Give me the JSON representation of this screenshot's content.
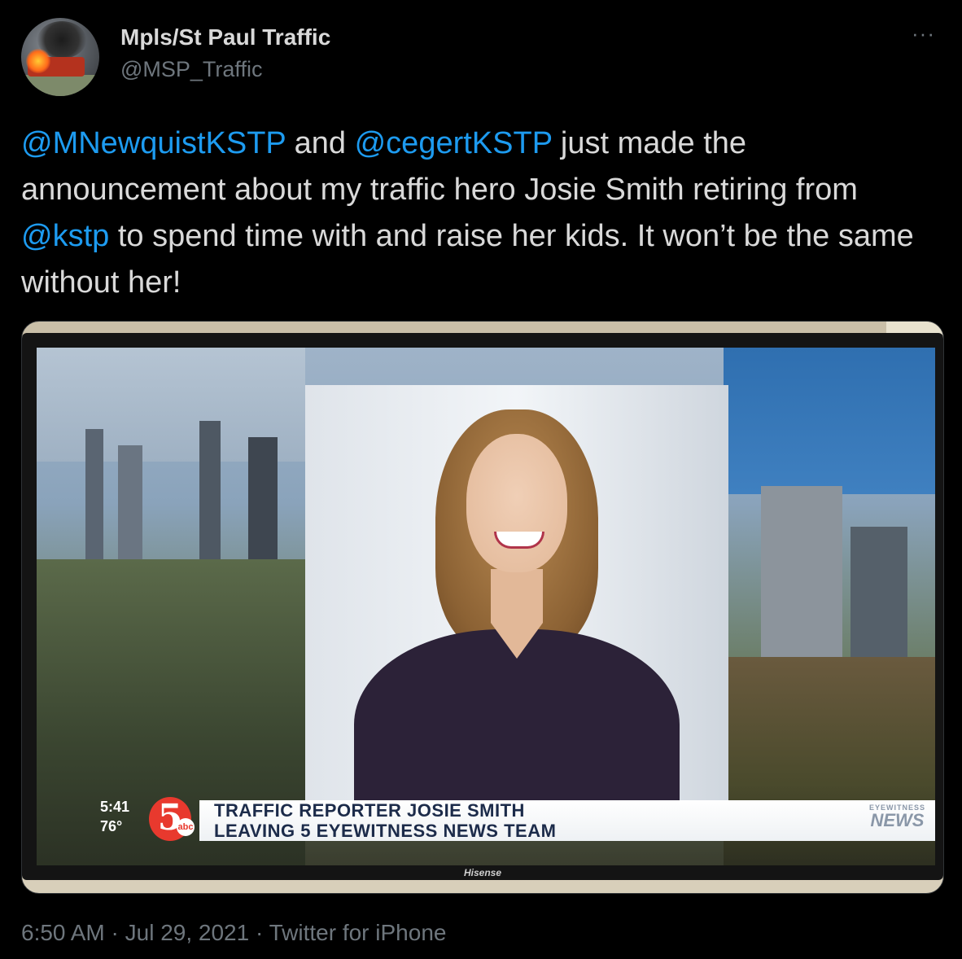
{
  "author": {
    "display_name": "Mpls/St Paul Traffic",
    "handle": "@MSP_Traffic",
    "avatar_icon": "avatar-bus-fire-icon"
  },
  "more_menu": {
    "icon": "more-icon",
    "label": "···"
  },
  "tweet": {
    "segments": [
      {
        "text": "@MNewquistKSTP",
        "type": "mention"
      },
      {
        "text": " and ",
        "type": "text"
      },
      {
        "text": "@cegertKSTP",
        "type": "mention"
      },
      {
        "text": " just made the announcement about my traffic hero Josie Smith retiring from ",
        "type": "text"
      },
      {
        "text": "@kstp",
        "type": "mention"
      },
      {
        "text": " to spend time with and raise her kids. It won’t be the same without her!",
        "type": "text"
      }
    ]
  },
  "media": {
    "tv": {
      "time": "5:41",
      "temp": "76°",
      "logo_number": "5",
      "logo_network": "abc",
      "headline_line1": "TRAFFIC REPORTER JOSIE SMITH",
      "headline_line2": "LEAVING 5 EYEWITNESS NEWS TEAM",
      "badge_top": "EYEWITNESS",
      "badge_bottom": "NEWS",
      "brand": "Hisense"
    }
  },
  "meta": {
    "time": "6:50 AM",
    "separator": " · ",
    "date": "Jul 29, 2021",
    "source": "Twitter for iPhone"
  },
  "colors": {
    "mention": "#1d9bf0",
    "text": "#d9d9d9",
    "muted": "#6e767d",
    "background": "#000000"
  }
}
